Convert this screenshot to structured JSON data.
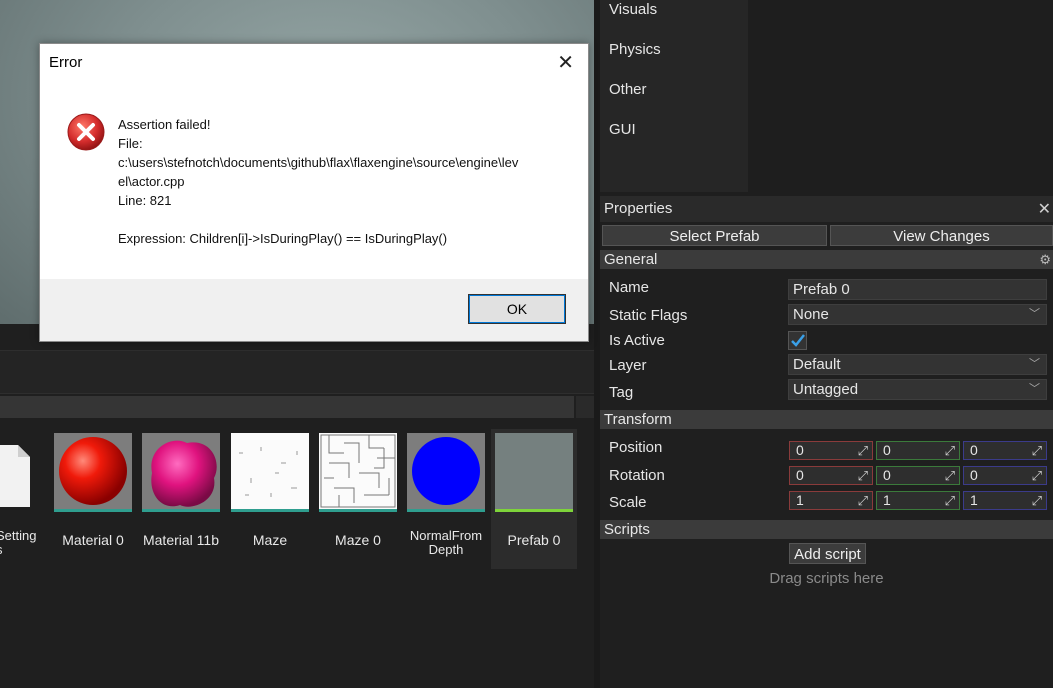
{
  "toolbox": {
    "items": [
      "Visuals",
      "Physics",
      "Other",
      "GUI"
    ]
  },
  "content": {
    "assets": [
      {
        "label": "Settings",
        "label_lines": [
          "Setting",
          "s"
        ],
        "icon": "document-icon"
      },
      {
        "label": "Material 0",
        "icon": "red-sphere-thumbnail"
      },
      {
        "label": "Material 11b",
        "icon": "pink-blob-thumbnail"
      },
      {
        "label": "Maze",
        "icon": "maze-texture-thumbnail"
      },
      {
        "label": "Maze 0",
        "icon": "maze-grid-thumbnail"
      },
      {
        "label": "NormalFromDepth",
        "label_lines": [
          "NormalFrom",
          "Depth"
        ],
        "icon": "blue-sphere-thumbnail"
      },
      {
        "label": "Prefab 0",
        "icon": "prefab-thumbnail"
      }
    ]
  },
  "properties": {
    "title": "Properties",
    "select_prefab": "Select Prefab",
    "view_changes": "View Changes",
    "general": {
      "header": "General",
      "name_label": "Name",
      "name_value": "Prefab 0",
      "static_flags_label": "Static Flags",
      "static_flags_value": "None",
      "is_active_label": "Is Active",
      "is_active": true,
      "layer_label": "Layer",
      "layer_value": "Default",
      "tag_label": "Tag",
      "tag_value": "Untagged"
    },
    "transform": {
      "header": "Transform",
      "position_label": "Position",
      "position": [
        "0",
        "0",
        "0"
      ],
      "rotation_label": "Rotation",
      "rotation": [
        "0",
        "0",
        "0"
      ],
      "scale_label": "Scale",
      "scale": [
        "1",
        "1",
        "1"
      ]
    },
    "scripts": {
      "header": "Scripts",
      "add_script": "Add script",
      "drag_hint": "Drag scripts here"
    }
  },
  "dialog": {
    "title": "Error",
    "lines": [
      "Assertion failed!",
      "File:",
      "c:\\users\\stefnotch\\documents\\github\\flax\\flaxengine\\source\\engine\\lev",
      "el\\actor.cpp",
      "Line: 821",
      "",
      "Expression: Children[i]->IsDuringPlay() == IsDuringPlay()"
    ],
    "ok_label": "OK"
  },
  "colors": {
    "accent": "#0078d7",
    "error_red": "#d42c2c",
    "selected_bar": "#7ed43a",
    "thumb_bar": "#2f9e8f"
  }
}
